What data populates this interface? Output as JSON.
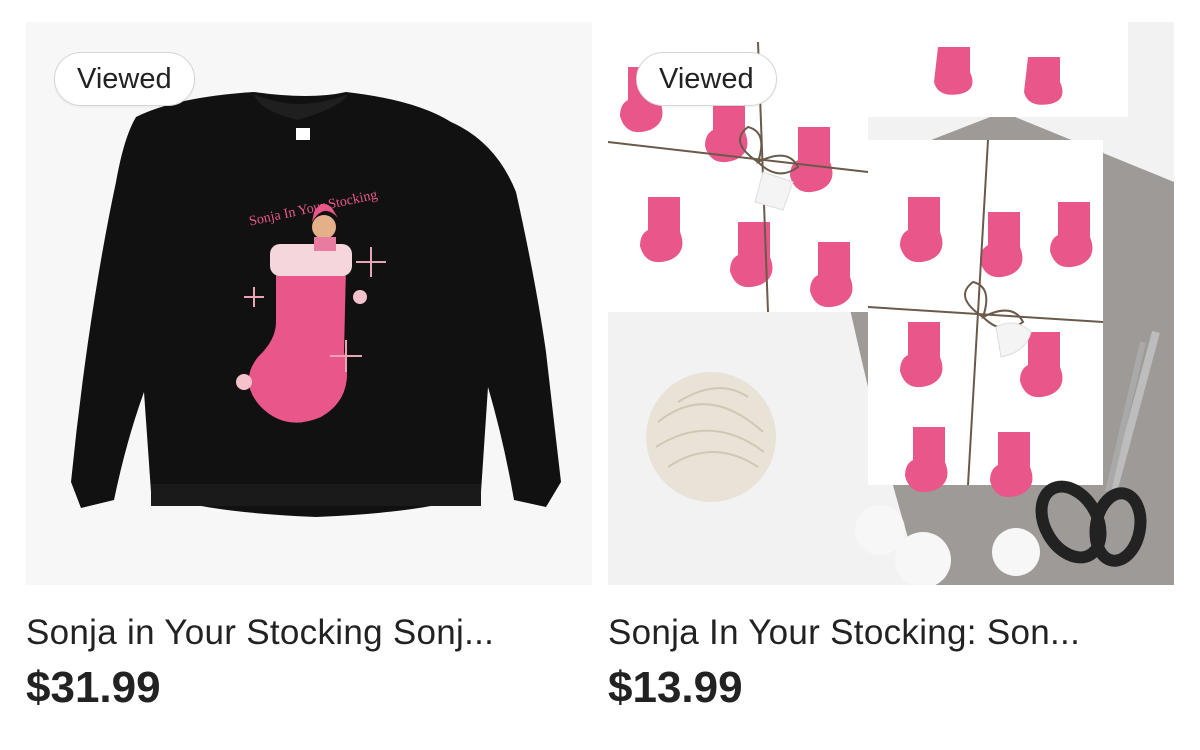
{
  "listings": [
    {
      "badge": "Viewed",
      "title": "Sonja in Your Stocking Sonj...",
      "price": "$31.99",
      "image_text": "Sonja In Your Stocking"
    },
    {
      "badge": "Viewed",
      "title": "Sonja In Your Stocking: Son...",
      "price": "$13.99"
    }
  ],
  "colors": {
    "text": "#222222",
    "stocking_pink": "#e9578a",
    "sweater": "#111111"
  }
}
